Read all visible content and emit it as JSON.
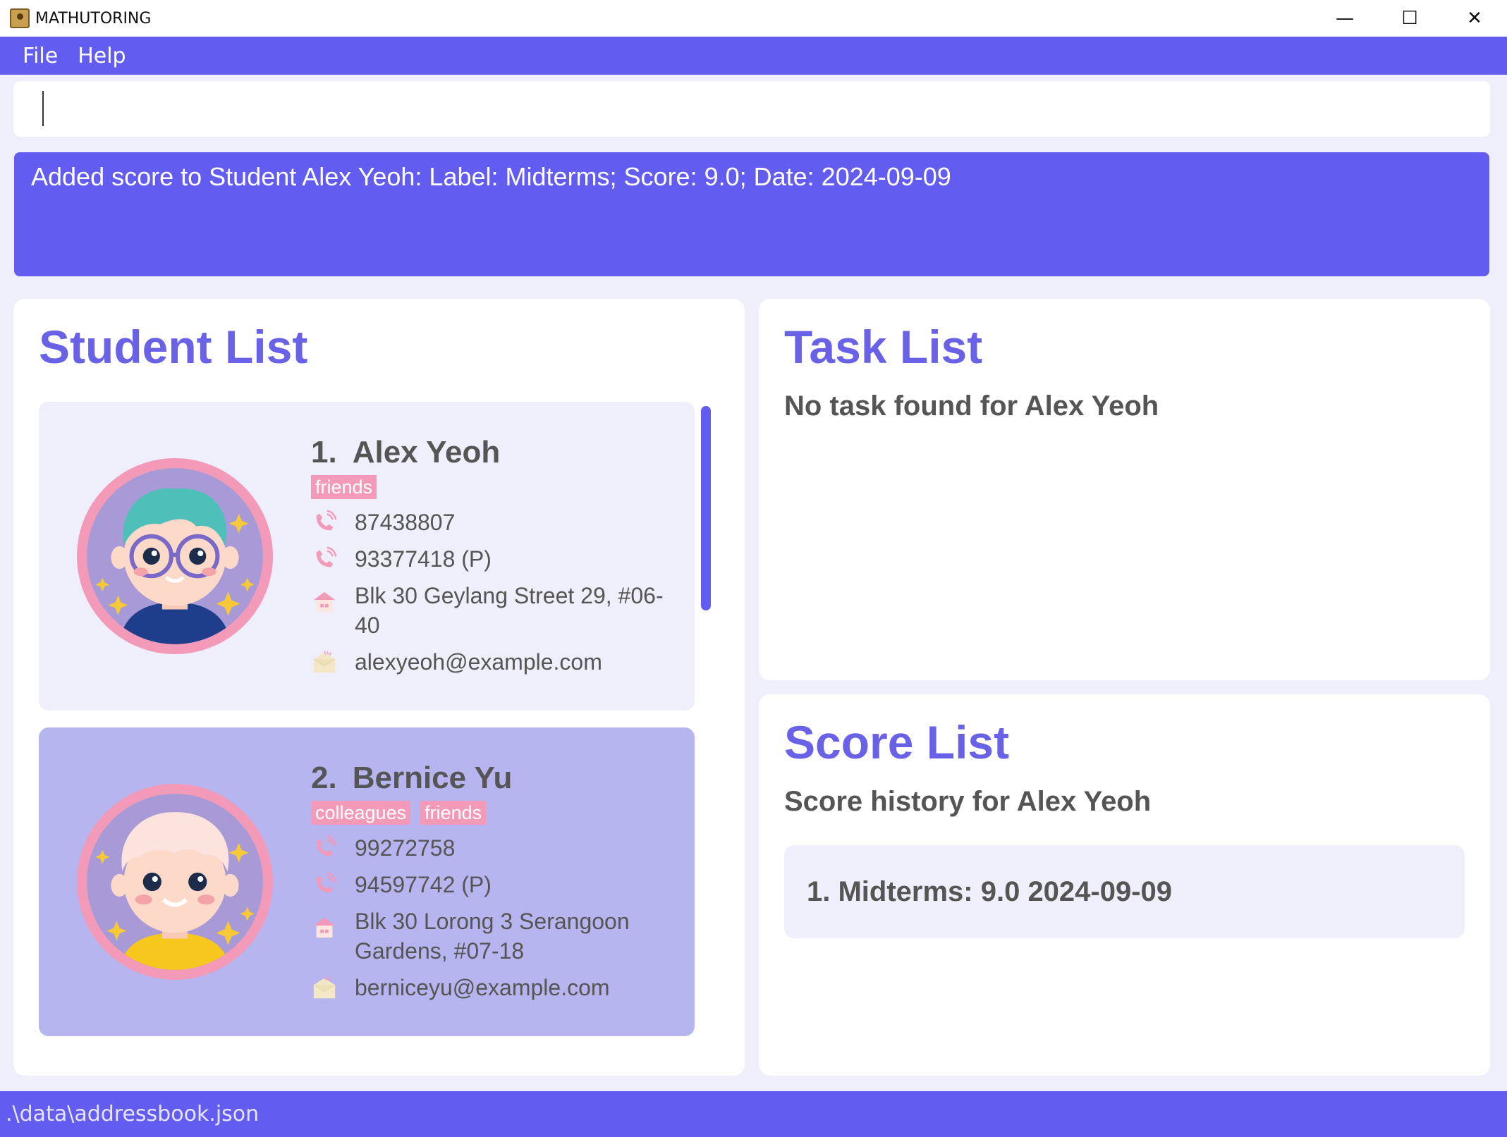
{
  "window": {
    "title": "MATHUTORING",
    "controls": {
      "minimize": "—",
      "maximize": "☐",
      "close": "✕"
    }
  },
  "menu": {
    "items": [
      "File",
      "Help"
    ]
  },
  "command": {
    "value": "",
    "placeholder": ""
  },
  "result": {
    "message": "Added score to Student Alex Yeoh: Label: Midterms; Score: 9.0; Date: 2024-09-09"
  },
  "student_list": {
    "title": "Student List",
    "students": [
      {
        "index": "1.",
        "name": "Alex Yeoh",
        "tags": [
          "friends"
        ],
        "phone": "87438807",
        "parent_phone": "93377418 (P)",
        "address": "Blk 30 Geylang Street 29, #06-40",
        "email": "alexyeoh@example.com",
        "avatar": "boy-with-glasses-avatar",
        "selected": false
      },
      {
        "index": "2.",
        "name": "Bernice Yu",
        "tags": [
          "colleagues",
          "friends"
        ],
        "phone": "99272758",
        "parent_phone": "94597742 (P)",
        "address": "Blk 30 Lorong 3 Serangoon Gardens, #07-18",
        "email": "berniceyu@example.com",
        "avatar": "blonde-child-avatar",
        "selected": true
      }
    ]
  },
  "task_list": {
    "title": "Task List",
    "message": "No task found for Alex Yeoh"
  },
  "score_list": {
    "title": "Score List",
    "subtitle": "Score history for Alex Yeoh",
    "scores": [
      {
        "text": "1. Midterms: 9.0 2024-09-09"
      }
    ]
  },
  "status": {
    "path": ".\\data\\addressbook.json"
  },
  "colors": {
    "accent": "#625df0",
    "title": "#6a62e6",
    "tag": "#f29ab8",
    "card": "#efeefb",
    "card_selected": "#b7b5ef",
    "background": "#efeefb"
  },
  "icons": {
    "phone": "phone-icon",
    "parent_phone": "phone-icon",
    "address": "house-icon",
    "email": "envelope-icon"
  }
}
